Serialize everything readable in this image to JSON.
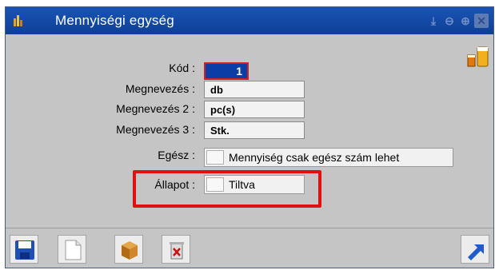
{
  "window": {
    "title": "Mennyiségi egység",
    "title_icons": [
      "download-icon",
      "zoom-out-icon",
      "zoom-in-icon",
      "close-icon"
    ]
  },
  "form": {
    "kod": {
      "label": "Kód :",
      "value": "1"
    },
    "megnevezes": {
      "label": "Megnevezés :",
      "value": "db"
    },
    "megnevezes2": {
      "label": "Megnevezés 2 :",
      "value": "pc(s)"
    },
    "megnevezes3": {
      "label": "Megnevezés 3 :",
      "value": "Stk."
    },
    "egesz": {
      "label": "Egész :",
      "text": "Mennyiség csak egész szám lehet",
      "checked": false
    },
    "allapot": {
      "label": "Állapot :",
      "text": "Tiltva",
      "checked": false
    }
  },
  "toolbar": {
    "buttons": [
      "save-icon",
      "new-document-icon",
      "package-icon",
      "delete-icon",
      "exit-arrow-icon"
    ]
  },
  "colors": {
    "title_bar": "#1a54b6",
    "window_bg": "#c5c5c5",
    "highlight": "#e01010",
    "selected_field": "#0a3ea6"
  }
}
